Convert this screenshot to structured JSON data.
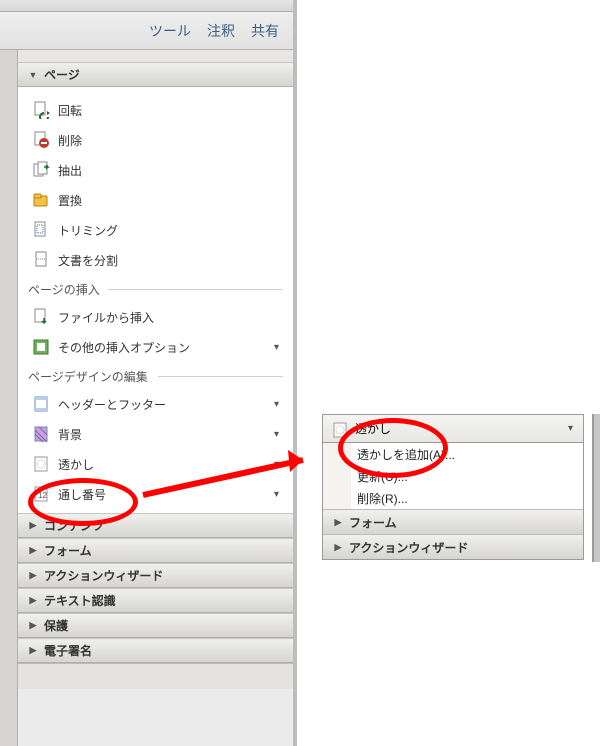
{
  "tabs": {
    "tools": "ツール",
    "comments": "注釈",
    "share": "共有"
  },
  "sections": {
    "page": {
      "title": "ページ",
      "items": {
        "rotate": "回転",
        "delete": "削除",
        "extract": "抽出",
        "replace": "置換",
        "trim": "トリミング",
        "split": "文書を分割"
      },
      "group_insert": "ページの挿入",
      "insert_items": {
        "from_file": "ファイルから挿入",
        "other_insert": "その他の挿入オプション"
      },
      "group_design": "ページデザインの編集",
      "design_items": {
        "header_footer": "ヘッダーとフッター",
        "background": "背景",
        "watermark": "透かし",
        "numbering": "通し番号"
      }
    },
    "contents": "コンテンツ",
    "form": "フォーム",
    "action_wizard": "アクションウィザード",
    "text_recognition": "テキスト認識",
    "protect": "保護",
    "esign": "電子署名"
  },
  "popup": {
    "header": "透かし",
    "menu": {
      "add": "透かしを追加(A)...",
      "update": "更新(U)...",
      "remove": "削除(R)..."
    },
    "footer_a": "フォーム",
    "footer_b": "アクションウィザード"
  }
}
